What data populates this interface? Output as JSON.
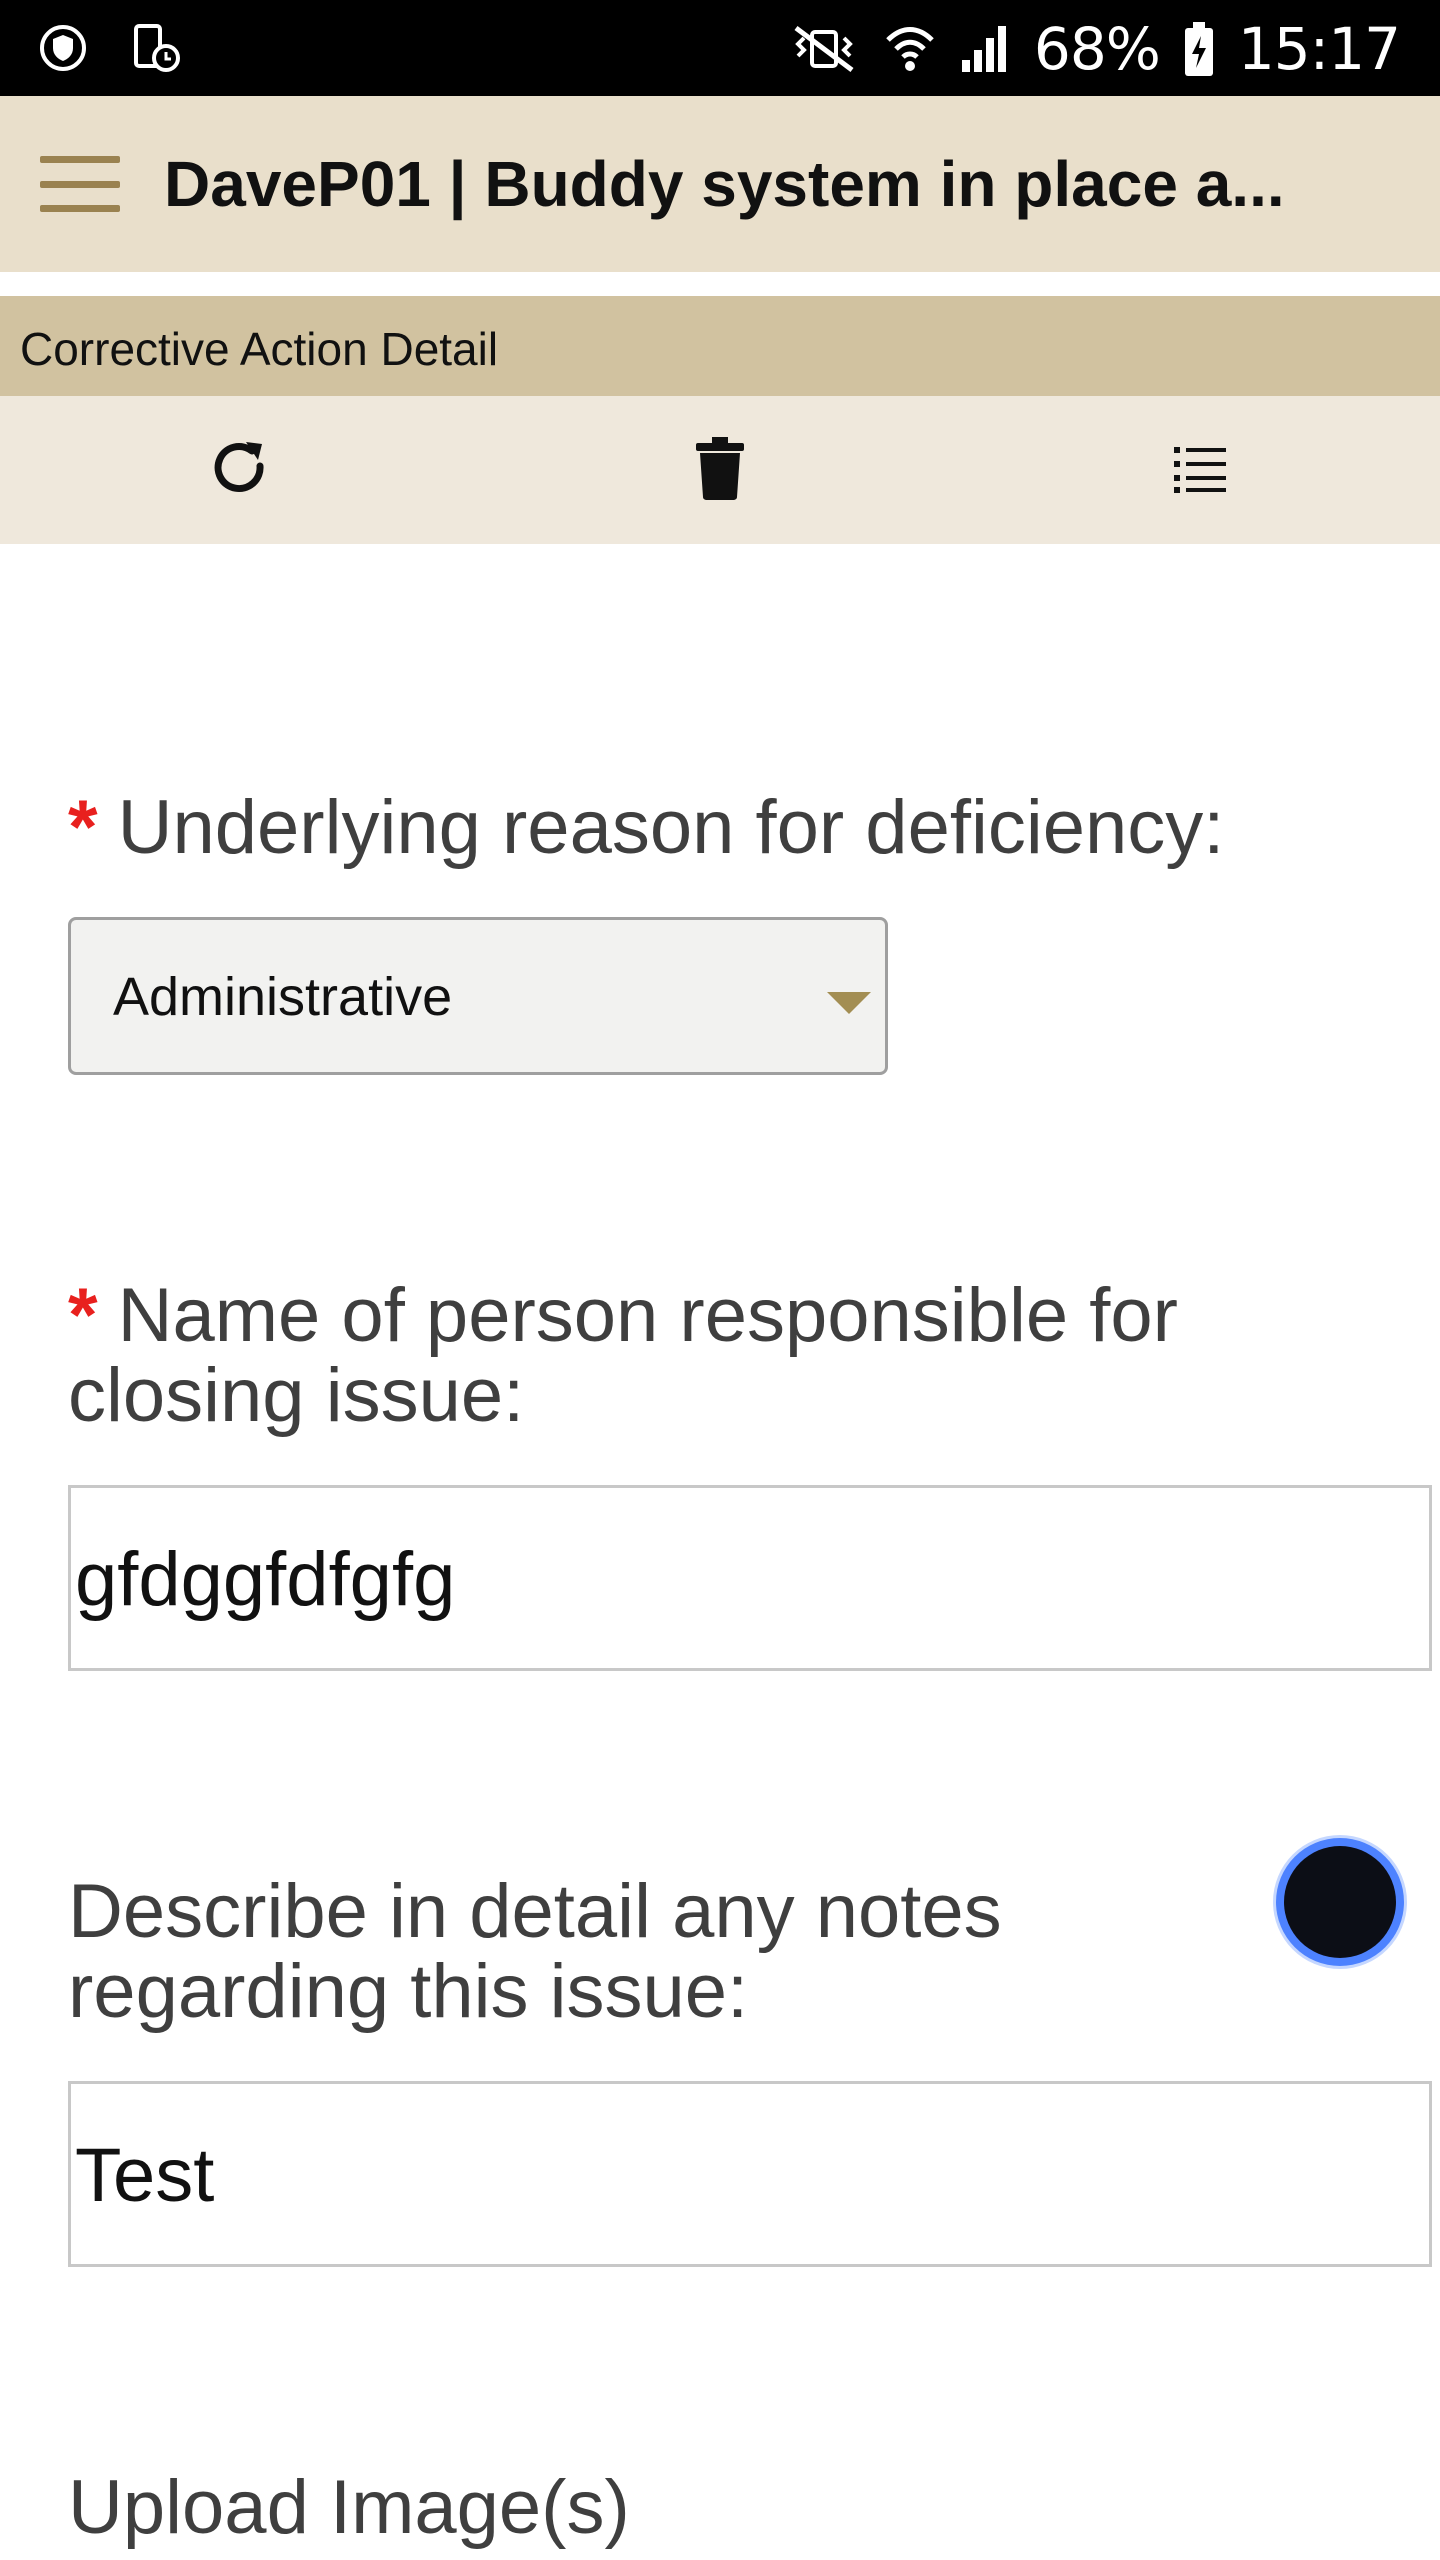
{
  "status_bar": {
    "battery": "68%",
    "time": "15:17",
    "icons": [
      "shield-icon",
      "device-clock-icon",
      "mute-vibrate-icon",
      "wifi-icon",
      "signal-icon",
      "battery-charging-icon"
    ]
  },
  "app_bar": {
    "menu_icon": "hamburger-menu-icon",
    "title": "DaveP01 | Buddy system in place a..."
  },
  "section": {
    "title": "Corrective Action Detail"
  },
  "toolbar": {
    "icons": [
      "refresh-icon",
      "delete-icon",
      "list-icon"
    ]
  },
  "form": {
    "reason": {
      "required": "*",
      "label": "Underlying reason for deficiency:",
      "value": "Administrative"
    },
    "person": {
      "required": "*",
      "label_line1": "Name of person responsible for",
      "label_line2": "closing issue:",
      "value": "gfdggfdfgfg"
    },
    "notes": {
      "label_line1": "Describe in detail any notes",
      "label_line2": "regarding this issue:",
      "value": "Test"
    },
    "upload": {
      "label": "Upload Image(s)"
    }
  },
  "colors": {
    "app_bar_bg": "#e9dfcb",
    "section_bg": "#d1c2a0",
    "toolbar_bg": "#efe8dc",
    "required": "#e8201e",
    "accent": "#a38e53"
  }
}
